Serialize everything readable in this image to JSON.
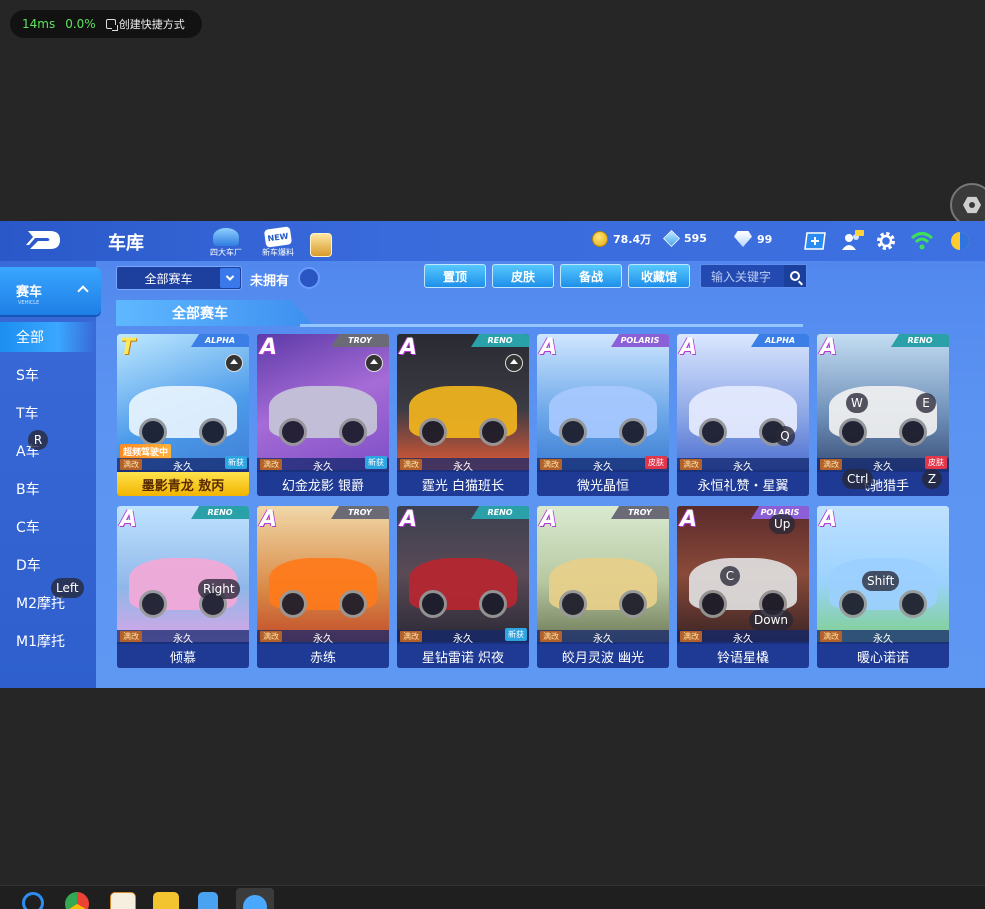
{
  "overlay": {
    "latency": "14ms",
    "loss": "0.0%",
    "shortcut_label": "创建快捷方式"
  },
  "header": {
    "title": "车库",
    "nav_icons": [
      {
        "label": "四大车厂",
        "icon": "car-factory-icon"
      },
      {
        "label": "新车爆料",
        "icon": "new-car-news-icon"
      },
      {
        "label": "",
        "icon": "gift-box-icon"
      }
    ],
    "currency": {
      "coins": "78.4万",
      "gems": "595",
      "diamonds": "99"
    }
  },
  "sidebar": {
    "head_label": "赛车",
    "head_sub": "VEHICLE",
    "items": [
      {
        "label": "全部"
      },
      {
        "label": "S车"
      },
      {
        "label": "T车"
      },
      {
        "label": "A车"
      },
      {
        "label": "B车"
      },
      {
        "label": "C车"
      },
      {
        "label": "D车"
      },
      {
        "label": "M2摩托"
      },
      {
        "label": "M1摩托"
      }
    ]
  },
  "filters": {
    "dropdown_value": "全部赛车",
    "unowned_label": "未拥有",
    "buttons": [
      "置顶",
      "皮肤",
      "备战",
      "收藏馆"
    ],
    "search_placeholder": "输入关键字"
  },
  "section": {
    "title": "全部赛车"
  },
  "cards": [
    {
      "grade": "T",
      "brand": "ALPHA",
      "name": "墨影青龙 敖丙",
      "perm": "永久",
      "maxmod": "满改",
      "tag": "新获",
      "banner": "超频驾驶中"
    },
    {
      "grade": "A",
      "brand": "TROY",
      "name": "幻金龙影 银爵",
      "perm": "永久",
      "maxmod": "满改",
      "tag": "新获"
    },
    {
      "grade": "A",
      "brand": "RENO",
      "name": "霆光 白猫班长",
      "perm": "永久",
      "maxmod": "满改"
    },
    {
      "grade": "A",
      "brand": "POLARIS",
      "name": "微光晶恒",
      "perm": "永久",
      "maxmod": "满改",
      "tag": "皮肤"
    },
    {
      "grade": "A",
      "brand": "ALPHA",
      "name": "永恒礼赞・星翼",
      "perm": "永久",
      "maxmod": "满改"
    },
    {
      "grade": "A",
      "brand": "RENO",
      "name": "飞驰猎手",
      "perm": "永久",
      "maxmod": "满改",
      "tag": "皮肤"
    },
    {
      "grade": "A",
      "brand": "RENO",
      "name": "倾慕",
      "perm": "永久",
      "maxmod": "满改"
    },
    {
      "grade": "A",
      "brand": "TROY",
      "name": "赤练",
      "perm": "永久",
      "maxmod": "满改"
    },
    {
      "grade": "A",
      "brand": "RENO",
      "name": "星钻雷诺 炽夜",
      "perm": "永久",
      "maxmod": "满改",
      "tag": "新获"
    },
    {
      "grade": "A",
      "brand": "TROY",
      "name": "皎月灵波 幽光",
      "perm": "永久",
      "maxmod": "满改"
    },
    {
      "grade": "A",
      "brand": "POLARIS",
      "name": "铃语星橇",
      "perm": "永久",
      "maxmod": "满改"
    },
    {
      "grade": "A",
      "brand": "",
      "name": "暖心诺诺",
      "perm": "永久",
      "maxmod": "满改"
    }
  ],
  "keys": [
    "R",
    "W",
    "E",
    "Q",
    "Ctrl",
    "Z",
    "Up",
    "C",
    "Left",
    "Right",
    "Shift",
    "Down"
  ],
  "colors": {
    "game_bg": "#5b93f2",
    "topbar": "#3a6bdc",
    "name_bar": "#1e3a94",
    "highlight": "#f2b400"
  }
}
